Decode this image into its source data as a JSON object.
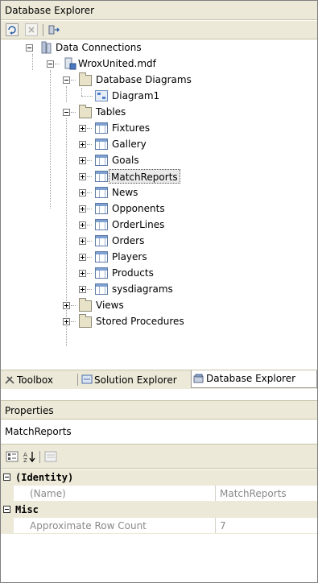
{
  "explorer": {
    "title": "Database Explorer",
    "toolbar": [
      {
        "icon": "refresh-icon"
      },
      {
        "icon": "delete-icon"
      },
      {
        "icon": "connect-to-database-icon"
      }
    ]
  },
  "tree": {
    "root": "Data Connections",
    "database": "WroxUnited.mdf",
    "diagrams_folder": "Database Diagrams",
    "diagram": "Diagram1",
    "tables_folder": "Tables",
    "tables": [
      "Fixtures",
      "Gallery",
      "Goals",
      "MatchReports",
      "News",
      "Opponents",
      "OrderLines",
      "Orders",
      "Players",
      "Products",
      "sysdiagrams"
    ],
    "selected_table": "MatchReports",
    "views_folder": "Views",
    "procs_folder": "Stored Procedures"
  },
  "tabs": [
    {
      "label": "Toolbox",
      "icon": "toolbox-icon",
      "active": false
    },
    {
      "label": "Solution Explorer",
      "icon": "solution-explorer-icon",
      "active": false
    },
    {
      "label": "Database Explorer",
      "icon": "database-explorer-icon",
      "active": true
    }
  ],
  "properties": {
    "title": "Properties",
    "object": "MatchReports",
    "toolbar": [
      {
        "icon": "categorized-icon"
      },
      {
        "icon": "alphabetical-icon"
      },
      {
        "icon": "property-pages-icon"
      }
    ],
    "categories": [
      {
        "name": "(Identity)",
        "rows": [
          {
            "name": "(Name)",
            "value": "MatchReports"
          }
        ]
      },
      {
        "name": "Misc",
        "rows": [
          {
            "name": "Approximate Row Count",
            "value": "7"
          }
        ]
      }
    ]
  }
}
